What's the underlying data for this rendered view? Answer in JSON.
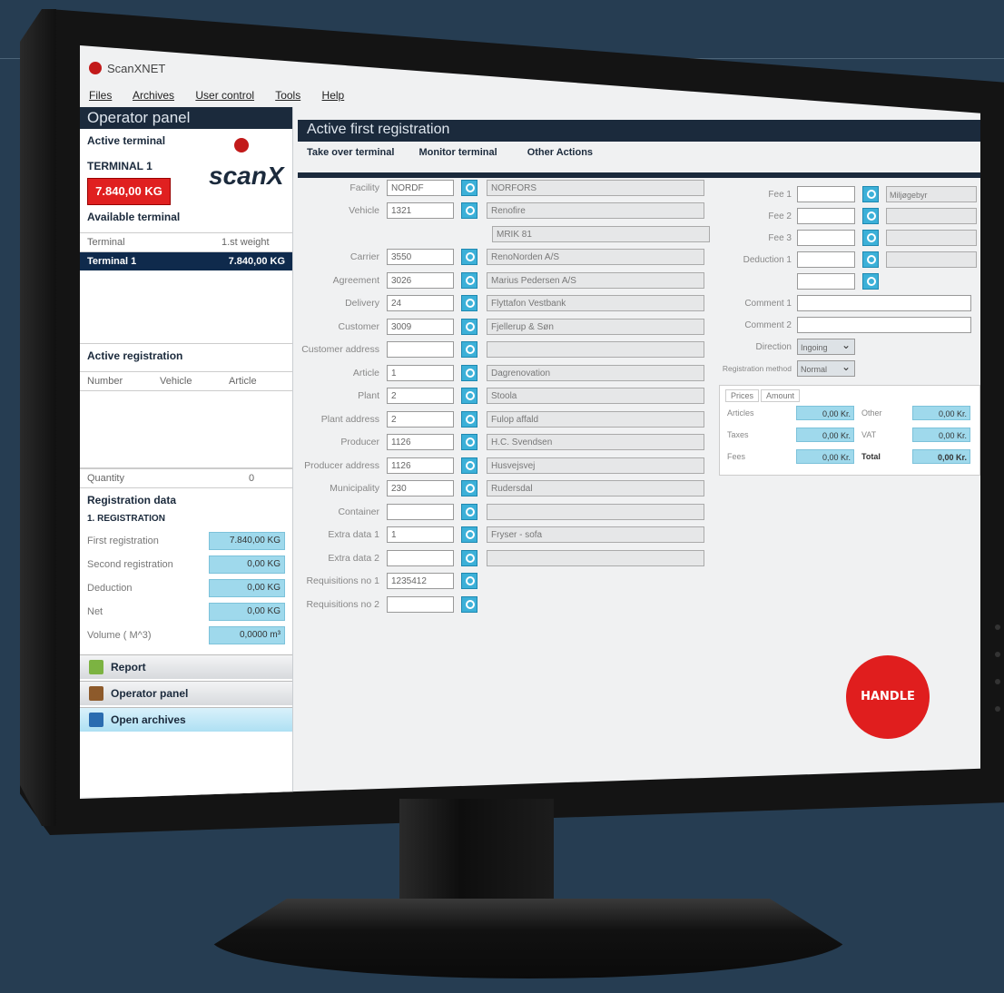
{
  "app": {
    "title": "ScanXNET",
    "window_controls": "— ☐ ×"
  },
  "menu": [
    "Files",
    "Archives",
    "User control",
    "Tools",
    "Help"
  ],
  "operator_panel": {
    "title": "Operator panel",
    "active_terminal_label": "Active terminal",
    "terminal_name": "TERMINAL 1",
    "terminal_weight": "7.840,00 KG",
    "brand": "scanX",
    "available_terminal_label": "Available terminal",
    "table_headers": [
      "Terminal",
      "1.st weight"
    ],
    "selected_row": {
      "terminal": "Terminal 1",
      "weight": "7.840,00 KG"
    }
  },
  "active_registration": {
    "title": "Active registration",
    "headers": [
      "Number",
      "Vehicle",
      "Article"
    ],
    "quantity_label": "Quantity",
    "quantity_value": "0"
  },
  "registration_data": {
    "title": "Registration data",
    "sub": "1. REGISTRATION",
    "rows": [
      {
        "label": "First registration",
        "value": "7.840,00 KG"
      },
      {
        "label": "Second registration",
        "value": "0,00 KG"
      },
      {
        "label": "Deduction",
        "value": "0,00 KG"
      },
      {
        "label": "Net",
        "value": "0,00 KG"
      },
      {
        "label": "Volume ( M^3)",
        "value": "0,0000 m³"
      }
    ]
  },
  "nav": [
    {
      "label": "Report",
      "icon": "report-icon",
      "color": "#7cb342"
    },
    {
      "label": "Operator panel",
      "icon": "operator-panel-icon",
      "color": "#8d5a2b"
    },
    {
      "label": "Open archives",
      "icon": "archives-icon",
      "color": "#2b6cb0"
    }
  ],
  "main": {
    "title": "Active first registration",
    "tabs": [
      "Take over terminal",
      "Monitor terminal",
      "Other Actions"
    ],
    "fields": [
      {
        "label": "Facility",
        "value": "NORDF",
        "desc": "NORFORS"
      },
      {
        "label": "Vehicle",
        "value": "1321",
        "desc": "Renofire"
      },
      {
        "label": "",
        "value": "",
        "desc": "MRIK 81"
      },
      {
        "label": "Carrier",
        "value": "3550",
        "desc": "RenoNorden A/S"
      },
      {
        "label": "Agreement",
        "value": "3026",
        "desc": "Marius Pedersen A/S"
      },
      {
        "label": "Delivery",
        "value": "24",
        "desc": "Flyttafon Vestbank"
      },
      {
        "label": "Customer",
        "value": "3009",
        "desc": "Fjellerup & Søn"
      },
      {
        "label": "Customer address",
        "value": "",
        "desc": ""
      },
      {
        "label": "Article",
        "value": "1",
        "desc": "Dagrenovation"
      },
      {
        "label": "Plant",
        "value": "2",
        "desc": "Stoola"
      },
      {
        "label": "Plant address",
        "value": "2",
        "desc": "Fulop affald"
      },
      {
        "label": "Producer",
        "value": "1126",
        "desc": "H.C. Svendsen"
      },
      {
        "label": "Producer address",
        "value": "1126",
        "desc": "Husvejsvej"
      },
      {
        "label": "Municipality",
        "value": "230",
        "desc": "Rudersdal"
      },
      {
        "label": "Container",
        "value": "",
        "desc": ""
      },
      {
        "label": "Extra data 1",
        "value": "1",
        "desc": "Fryser - sofa"
      },
      {
        "label": "Extra data 2",
        "value": "",
        "desc": ""
      },
      {
        "label": "Requisitions no 1",
        "value": "1235412",
        "desc": null
      },
      {
        "label": "Requisitions no 2",
        "value": "",
        "desc": null
      }
    ],
    "right": {
      "fees": [
        {
          "label": "Fee 1",
          "desc": "Miljøgebyr"
        },
        {
          "label": "Fee 2",
          "desc": ""
        },
        {
          "label": "Fee 3",
          "desc": ""
        },
        {
          "label": "Deduction 1",
          "desc": ""
        },
        {
          "label": "",
          "desc": null
        }
      ],
      "comment1": "Comment 1",
      "comment2": "Comment 2",
      "direction_label": "Direction",
      "direction_value": "Ingoing",
      "method_label": "Registration method",
      "method_value": "Normal",
      "price_tabs": [
        "Prices",
        "Amount"
      ],
      "price_rows": [
        {
          "l1": "Articles",
          "v1": "0,00 Kr.",
          "l2": "Other",
          "v2": "0,00 Kr."
        },
        {
          "l1": "Taxes",
          "v1": "0,00 Kr.",
          "l2": "VAT",
          "v2": "0,00 Kr."
        },
        {
          "l1": "Fees",
          "v1": "0,00 Kr.",
          "l2": "Total",
          "v2": "0,00 Kr."
        }
      ]
    },
    "handle_label": "HANDLE"
  }
}
